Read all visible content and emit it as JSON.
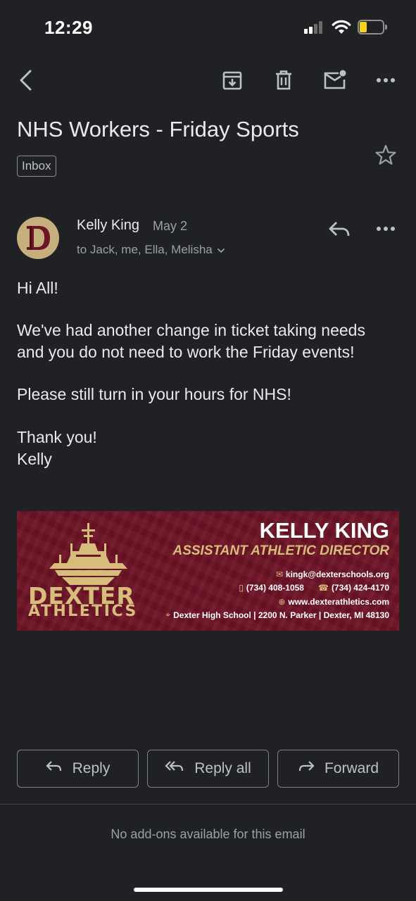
{
  "status_bar": {
    "time": "12:29",
    "battery_level": 0.3,
    "battery_color": "#f5d417"
  },
  "toolbar": {
    "back_icon": "back-arrow-icon",
    "archive_icon": "archive-icon",
    "delete_icon": "trash-icon",
    "mark_unread_icon": "mark-unread-icon",
    "more_icon": "more-horizontal-icon"
  },
  "email": {
    "subject": "NHS Workers - Friday Sports",
    "label": "Inbox",
    "starred": false,
    "sender": {
      "name": "Kelly King",
      "date": "May 2",
      "recipients": "to Jack, me, Ella, Melisha",
      "avatar_color": "#c5b07d",
      "avatar_letter_color": "#6e1426"
    },
    "body": {
      "greeting": "Hi All!",
      "paragraph1_line1": "We've had another change in ticket taking needs",
      "paragraph1_line2": "and you do not need to work the Friday events!",
      "paragraph2": "Please still turn in your hours for NHS!",
      "closing": "Thank you!",
      "signoff": "Kelly"
    },
    "signature": {
      "name": "KELLY KING",
      "title": "ASSISTANT ATHLETIC DIRECTOR",
      "email": "kingk@dexterschools.org",
      "mobile": "(734) 408-1058",
      "phone": "(734) 424-4170",
      "website": "www.dexterathletics.com",
      "address": "Dexter High School | 2200 N. Parker | Dexter, MI 48130",
      "logo_line1": "DEXTER",
      "logo_line2": "ATHLETICS",
      "background_color": "#6e1426",
      "accent_color": "#d7bd7b"
    }
  },
  "actions": {
    "reply": "Reply",
    "reply_all": "Reply all",
    "forward": "Forward"
  },
  "footer": {
    "addons_text": "No add-ons available for this email"
  }
}
